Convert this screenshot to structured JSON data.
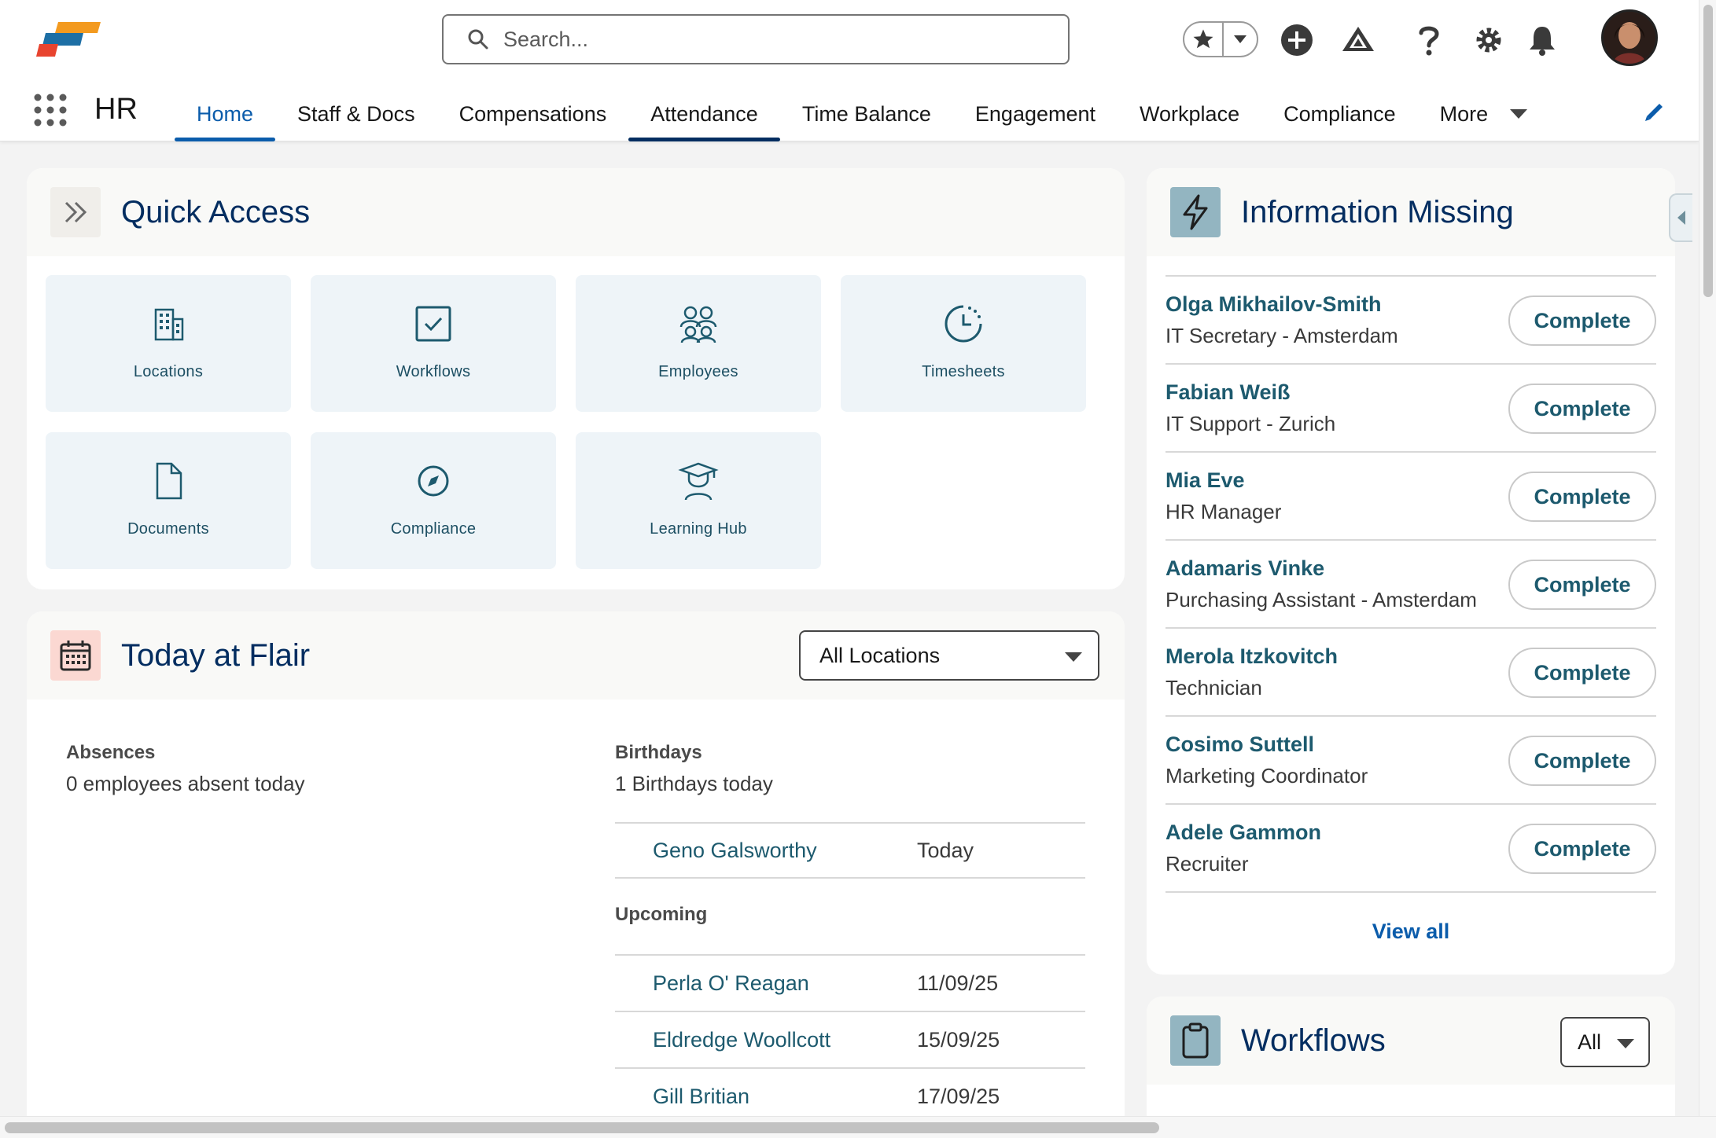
{
  "search": {
    "placeholder": "Search..."
  },
  "app": {
    "name": "HR"
  },
  "tabs": [
    {
      "label": "Home"
    },
    {
      "label": "Staff & Docs"
    },
    {
      "label": "Compensations"
    },
    {
      "label": "Attendance"
    },
    {
      "label": "Time Balance"
    },
    {
      "label": "Engagement"
    },
    {
      "label": "Workplace"
    },
    {
      "label": "Compliance"
    },
    {
      "label": "More"
    }
  ],
  "header_icons": [
    "star-icon",
    "chevron-down-icon",
    "add-icon",
    "trailhead-icon",
    "help-icon",
    "gear-icon",
    "bell-icon"
  ],
  "quick_access": {
    "title": "Quick Access",
    "tiles": [
      {
        "label": "Locations",
        "icon": "building-icon"
      },
      {
        "label": "Workflows",
        "icon": "checkbox-icon"
      },
      {
        "label": "Employees",
        "icon": "people-icon"
      },
      {
        "label": "Timesheets",
        "icon": "clock-icon"
      },
      {
        "label": "Documents",
        "icon": "document-icon"
      },
      {
        "label": "Compliance",
        "icon": "compass-icon"
      },
      {
        "label": "Learning Hub",
        "icon": "graduate-icon"
      }
    ]
  },
  "today": {
    "title": "Today at Flair",
    "location_filter": "All Locations",
    "absences_label": "Absences",
    "absences_text": "0 employees absent today",
    "birthdays_label": "Birthdays",
    "birthdays_text": "1 Birthdays today",
    "today_birthdays": [
      {
        "name": "Geno Galsworthy",
        "date": "Today"
      }
    ],
    "upcoming_label": "Upcoming",
    "upcoming": [
      {
        "name": "Perla O' Reagan",
        "date": "11/09/25"
      },
      {
        "name": "Eldredge Woollcott",
        "date": "15/09/25"
      },
      {
        "name": "Gill Britian",
        "date": "17/09/25"
      }
    ]
  },
  "info_missing": {
    "title": "Information Missing",
    "button_label": "Complete",
    "view_all": "View all",
    "people": [
      {
        "name": "Olga Mikhailov-Smith",
        "role": "IT Secretary - Amsterdam"
      },
      {
        "name": "Fabian Weiß",
        "role": "IT Support - Zurich"
      },
      {
        "name": "Mia Eve",
        "role": "HR Manager"
      },
      {
        "name": "Adamaris Vinke",
        "role": "Purchasing Assistant - Amsterdam"
      },
      {
        "name": "Merola Itzkovitch",
        "role": "Technician"
      },
      {
        "name": "Cosimo Suttell",
        "role": "Marketing Coordinator"
      },
      {
        "name": "Adele Gammon",
        "role": "Recruiter"
      }
    ]
  },
  "workflows": {
    "title": "Workflows",
    "filter": "All"
  },
  "colors": {
    "accent": "#0b5cab",
    "title": "#032d60",
    "link": "#1d5a6e",
    "tile_bg": "#eef4f8"
  }
}
